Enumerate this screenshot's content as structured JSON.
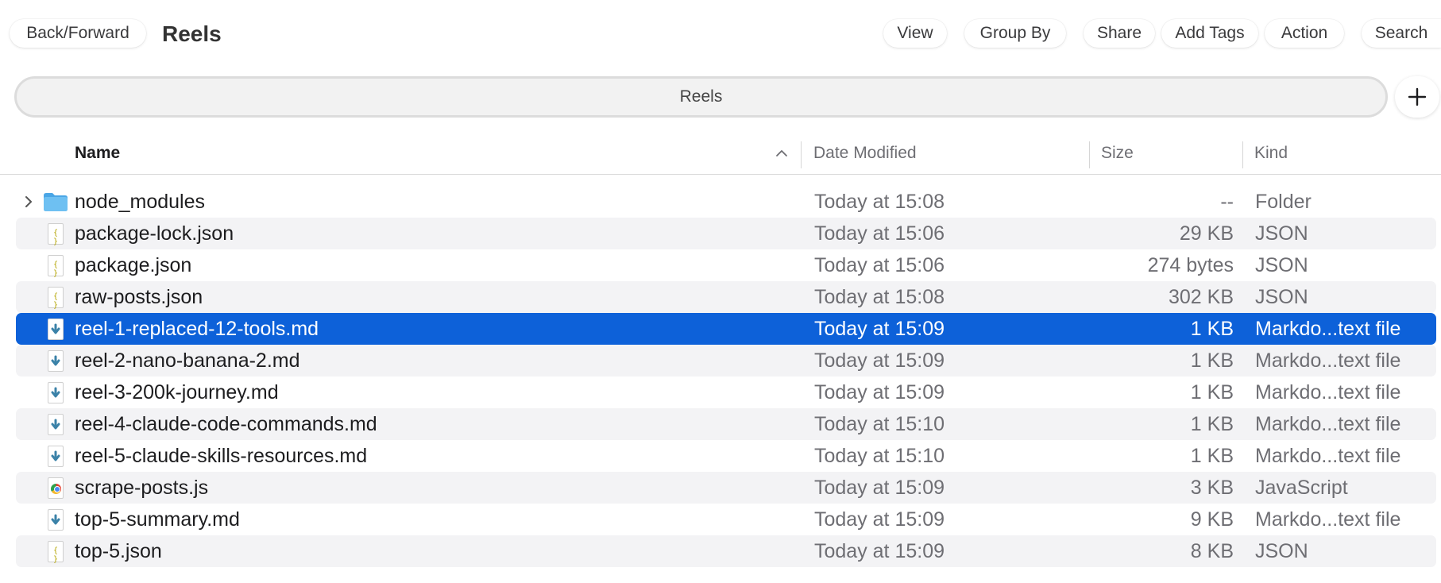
{
  "toolbar": {
    "back_forward": "Back/Forward",
    "title": "Reels",
    "view": "View",
    "group_by": "Group By",
    "share": "Share",
    "add_tags": "Add Tags",
    "action": "Action",
    "search": "Search"
  },
  "tabbar": {
    "tab_label": "Reels",
    "add_icon": "plus-icon"
  },
  "columns": {
    "name": "Name",
    "date_modified": "Date Modified",
    "size": "Size",
    "kind": "Kind",
    "sort_icon": "chevron-up-icon"
  },
  "colors": {
    "selection": "#0d61d9",
    "alt_row": "#f3f3f5",
    "folder": "#5cb4ee",
    "markdown_arrow": "#3b82a8"
  },
  "rows": [
    {
      "name": "node_modules",
      "date": "Today at 15:08",
      "size": "--",
      "kind": "Folder",
      "icon": "folder-icon",
      "expandable": true
    },
    {
      "name": "package-lock.json",
      "date": "Today at 15:06",
      "size": "29 KB",
      "kind": "JSON",
      "icon": "json-file-icon"
    },
    {
      "name": "package.json",
      "date": "Today at 15:06",
      "size": "274 bytes",
      "kind": "JSON",
      "icon": "json-file-icon"
    },
    {
      "name": "raw-posts.json",
      "date": "Today at 15:08",
      "size": "302 KB",
      "kind": "JSON",
      "icon": "json-file-icon"
    },
    {
      "name": "reel-1-replaced-12-tools.md",
      "date": "Today at 15:09",
      "size": "1 KB",
      "kind": "Markdo...text file",
      "icon": "markdown-file-icon",
      "selected": true
    },
    {
      "name": "reel-2-nano-banana-2.md",
      "date": "Today at 15:09",
      "size": "1 KB",
      "kind": "Markdo...text file",
      "icon": "markdown-file-icon"
    },
    {
      "name": "reel-3-200k-journey.md",
      "date": "Today at 15:09",
      "size": "1 KB",
      "kind": "Markdo...text file",
      "icon": "markdown-file-icon"
    },
    {
      "name": "reel-4-claude-code-commands.md",
      "date": "Today at 15:10",
      "size": "1 KB",
      "kind": "Markdo...text file",
      "icon": "markdown-file-icon"
    },
    {
      "name": "reel-5-claude-skills-resources.md",
      "date": "Today at 15:10",
      "size": "1 KB",
      "kind": "Markdo...text file",
      "icon": "markdown-file-icon"
    },
    {
      "name": "scrape-posts.js",
      "date": "Today at 15:09",
      "size": "3 KB",
      "kind": "JavaScript",
      "icon": "javascript-file-icon"
    },
    {
      "name": "top-5-summary.md",
      "date": "Today at 15:09",
      "size": "9 KB",
      "kind": "Markdo...text file",
      "icon": "markdown-file-icon"
    },
    {
      "name": "top-5.json",
      "date": "Today at 15:09",
      "size": "8 KB",
      "kind": "JSON",
      "icon": "json-file-icon"
    }
  ]
}
